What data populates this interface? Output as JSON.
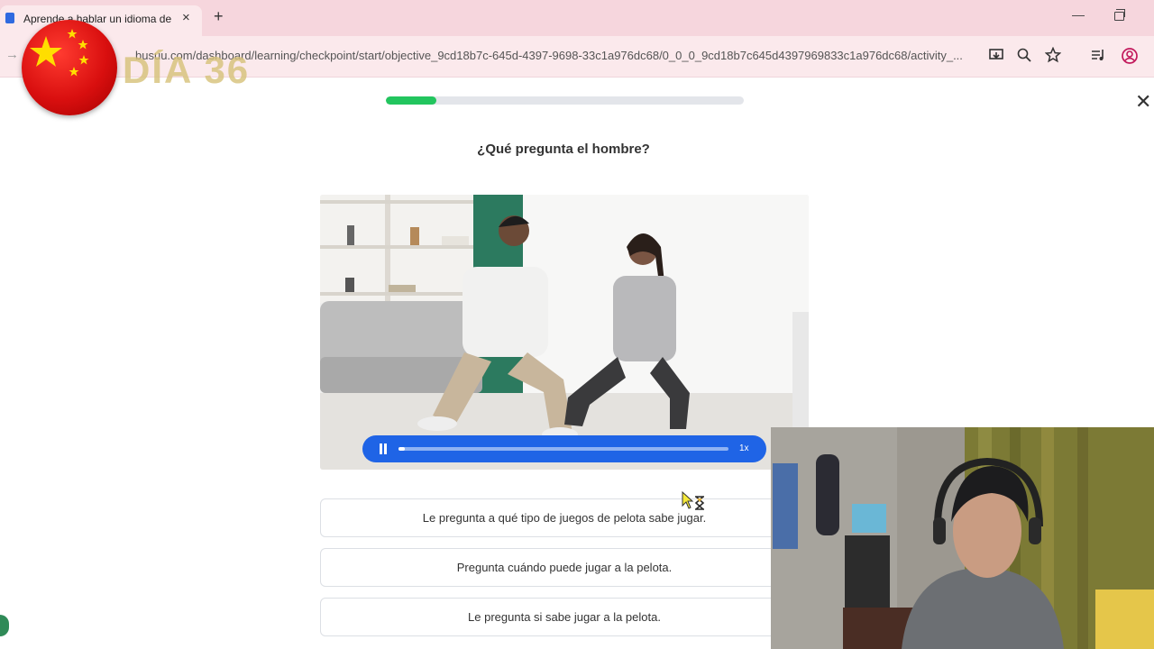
{
  "browser": {
    "tab_title": "Aprende a hablar un idioma de",
    "tab_close_icon": "×",
    "new_tab_icon": "+",
    "url": "busuu.com/dashboard/learning/checkpoint/start/objective_9cd18b7c-645d-4397-9698-33c1a976dc68/0_0_0_9cd18b7c645d4397969833c1a976dc68/activity_...",
    "icons": [
      "forward-icon",
      "install-app-icon",
      "zoom-icon",
      "bookmark-star-icon",
      "media-controls-icon",
      "profile-icon"
    ]
  },
  "overlay": {
    "day_label": "DÍA 36",
    "flag": "china-flag"
  },
  "lesson": {
    "progress_percent": 14,
    "question": "¿Qué pregunta el hombre?",
    "player": {
      "speed_label": "1x",
      "progress_percent": 1
    },
    "options": [
      "Le pregunta a qué tipo de juegos de pelota sabe jugar.",
      "Pregunta cuándo puede jugar a la pelota.",
      "Le pregunta si sabe jugar a la pelota."
    ]
  },
  "colors": {
    "progress": "#22c55e",
    "player": "#1f64e6",
    "tabbar": "#f6d6dd"
  }
}
